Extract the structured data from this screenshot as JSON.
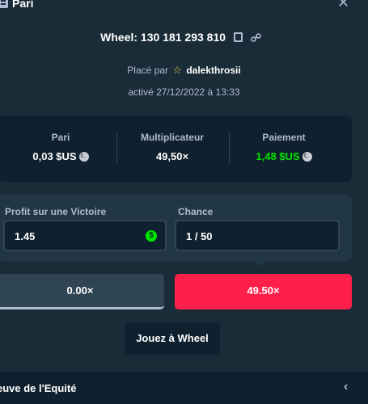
{
  "header": {
    "title": "Pari"
  },
  "bet": {
    "title": "Wheel: 130 181 293 810",
    "placed_prefix": "Placé par",
    "user": "dalekthrosii",
    "date": "activé 27/12/2022 à 13:33"
  },
  "stats": [
    {
      "label": "Pari",
      "value": "0,03 $US"
    },
    {
      "label": "Multiplicateur",
      "value": "49,50×"
    },
    {
      "label": "Paiement",
      "value": "1,48 $US"
    }
  ],
  "inputs": {
    "profit_label": "Profit sur une Victoire",
    "profit_value": "1.45",
    "currency_symbol": "$",
    "chance_label": "Chance",
    "chance_value": "1 / 50"
  },
  "segments": [
    {
      "label": "0.00×",
      "color": "#2f4553"
    },
    {
      "label": "49.50×",
      "color": "#ff1f4b"
    }
  ],
  "play_button": "Jouez à Wheel",
  "footer": {
    "title": "euve de l'Equité"
  },
  "colors": {
    "background": "#1a2c38",
    "panel_dark": "#0f212e",
    "panel": "#213743",
    "accent_green": "#00e701",
    "accent_red": "#ff1f4b",
    "muted_text": "#b1bad3"
  }
}
